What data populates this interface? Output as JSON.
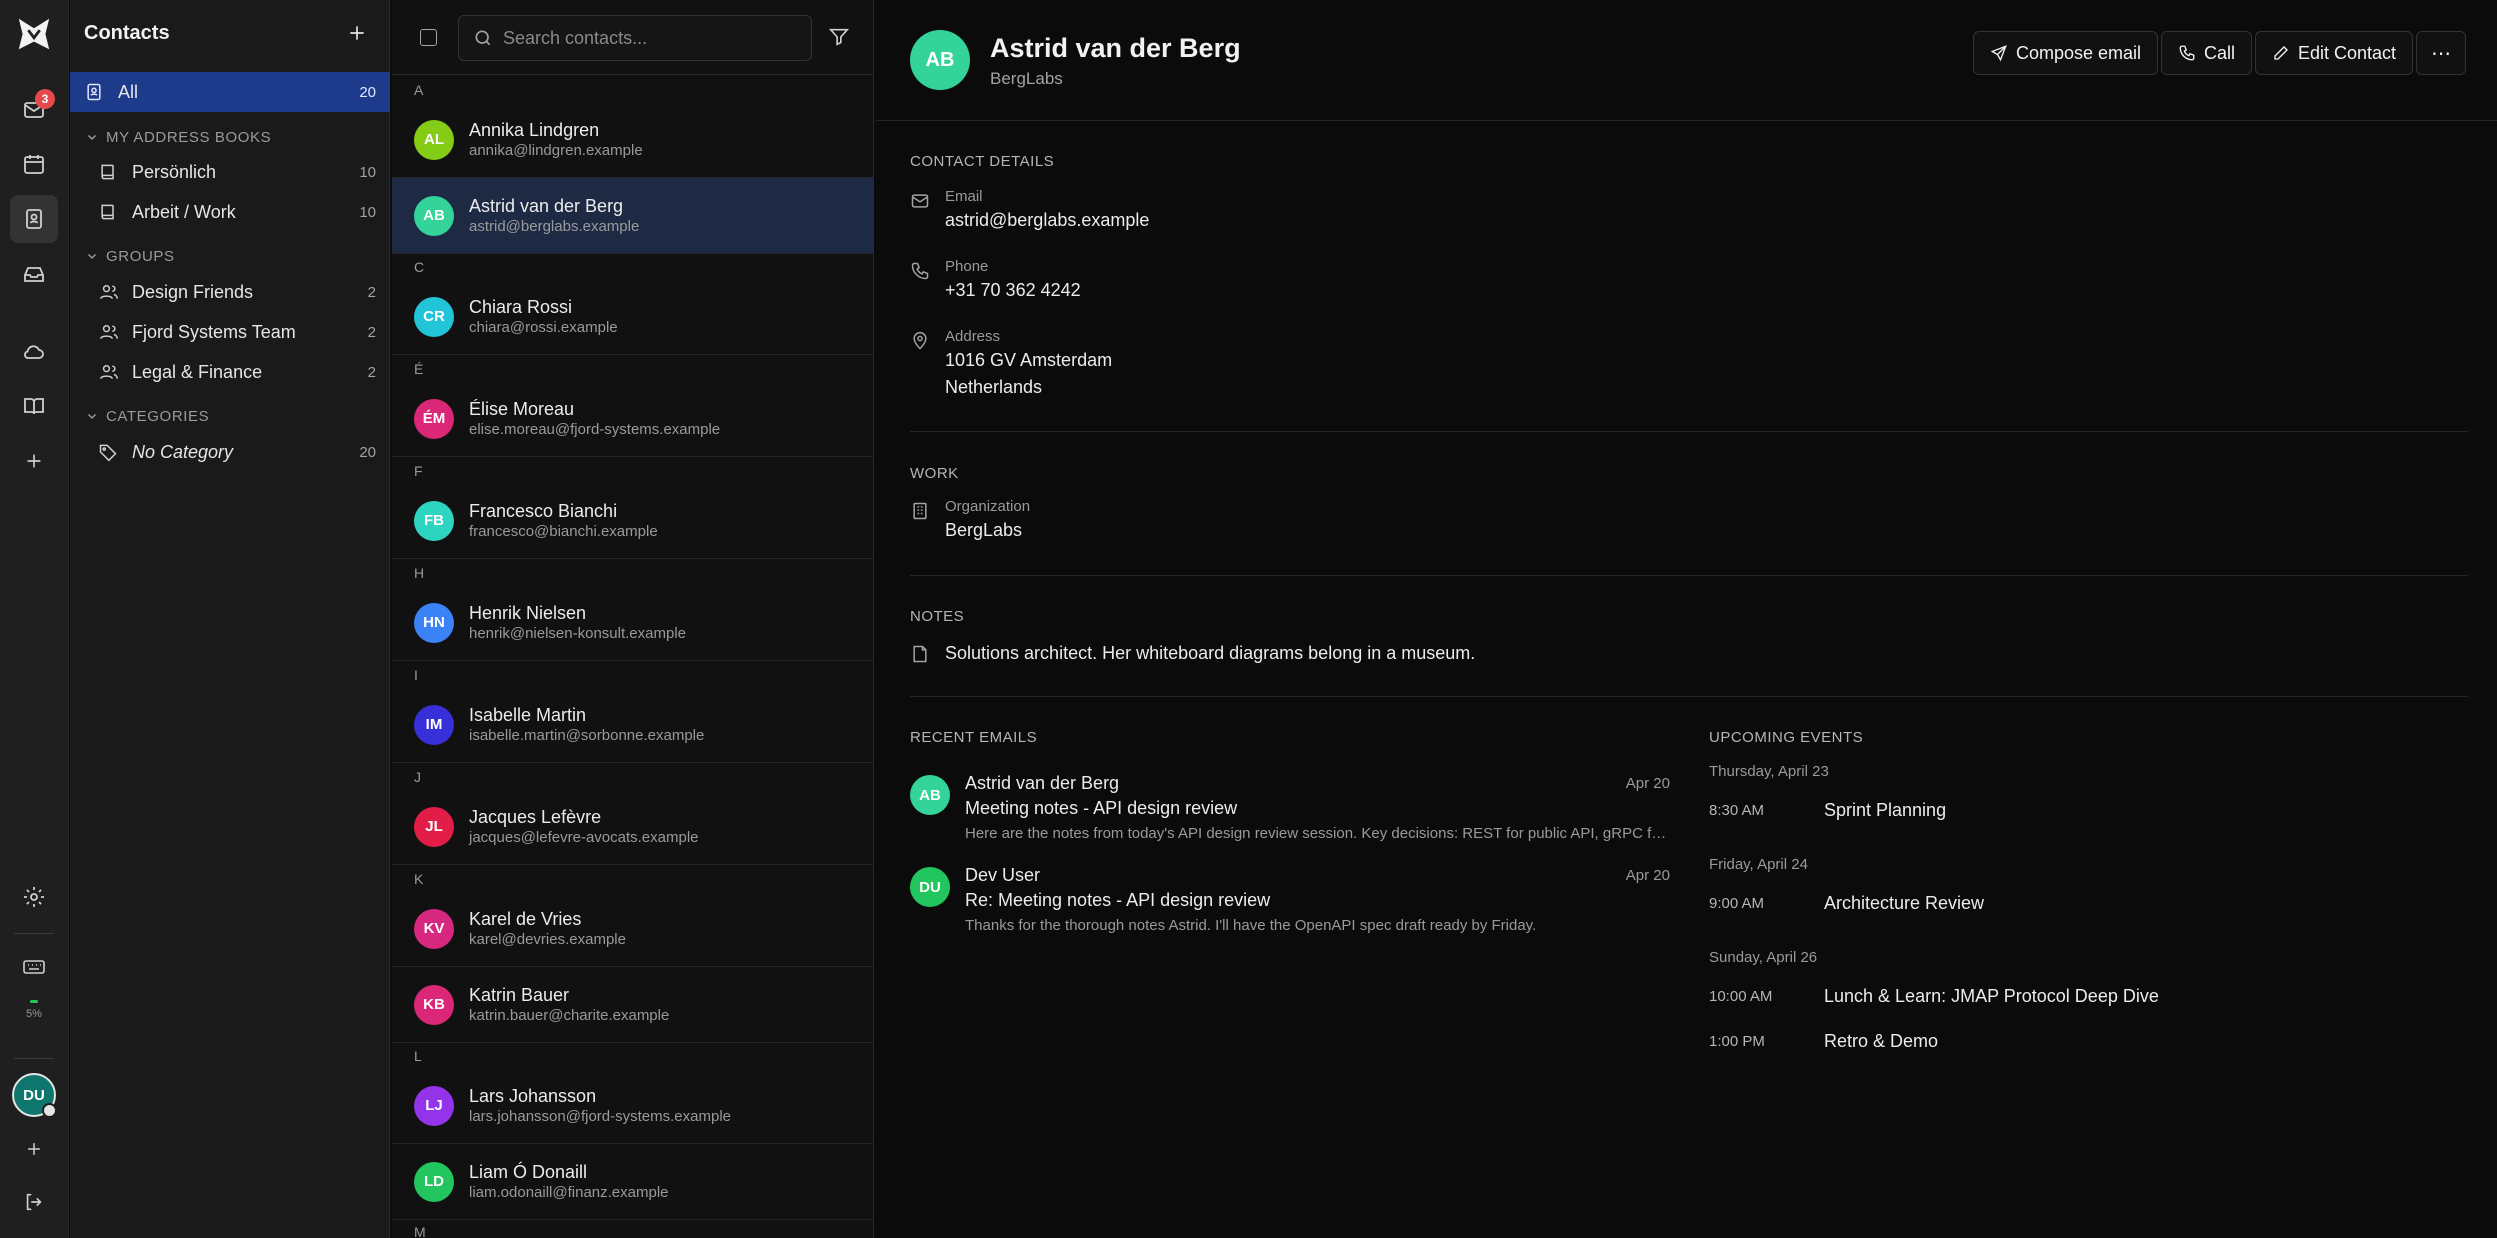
{
  "rail": {
    "mail_badge": "3",
    "quota": "5%",
    "avatar_initials": "DU"
  },
  "sidebar": {
    "title": "Contacts",
    "all": {
      "label": "All",
      "count": "20"
    },
    "address_books_header": "MY ADDRESS BOOKS",
    "address_books": [
      {
        "label": "Persönlich",
        "count": "10"
      },
      {
        "label": "Arbeit / Work",
        "count": "10"
      }
    ],
    "groups_header": "GROUPS",
    "groups": [
      {
        "label": "Design Friends",
        "count": "2"
      },
      {
        "label": "Fjord Systems Team",
        "count": "2"
      },
      {
        "label": "Legal & Finance",
        "count": "2"
      }
    ],
    "categories_header": "CATEGORIES",
    "categories": [
      {
        "label": "No Category",
        "count": "20"
      }
    ]
  },
  "list": {
    "search_placeholder": "Search contacts...",
    "letters": [
      "A",
      "C",
      "É",
      "F",
      "H",
      "I",
      "J",
      "K",
      "L",
      "M"
    ],
    "contacts": [
      {
        "initials": "AL",
        "name": "Annika Lindgren",
        "email": "annika@lindgren.example",
        "color": "#84cc16"
      },
      {
        "initials": "AB",
        "name": "Astrid van der Berg",
        "email": "astrid@berglabs.example",
        "color": "#34d399"
      },
      {
        "initials": "CR",
        "name": "Chiara Rossi",
        "email": "chiara@rossi.example",
        "color": "#22c5d8"
      },
      {
        "initials": "ÉM",
        "name": "Élise Moreau",
        "email": "elise.moreau@fjord-systems.example",
        "color": "#db2777"
      },
      {
        "initials": "FB",
        "name": "Francesco Bianchi",
        "email": "francesco@bianchi.example",
        "color": "#2dd4bf"
      },
      {
        "initials": "HN",
        "name": "Henrik Nielsen",
        "email": "henrik@nielsen-konsult.example",
        "color": "#3b82f6"
      },
      {
        "initials": "IM",
        "name": "Isabelle Martin",
        "email": "isabelle.martin@sorbonne.example",
        "color": "#3730d8"
      },
      {
        "initials": "JL",
        "name": "Jacques Lefèvre",
        "email": "jacques@lefevre-avocats.example",
        "color": "#e11d48"
      },
      {
        "initials": "KV",
        "name": "Karel de Vries",
        "email": "karel@devries.example",
        "color": "#d6287f"
      },
      {
        "initials": "KB",
        "name": "Katrin Bauer",
        "email": "katrin.bauer@charite.example",
        "color": "#db2777"
      },
      {
        "initials": "LJ",
        "name": "Lars Johansson",
        "email": "lars.johansson@fjord-systems.example",
        "color": "#9333ea"
      },
      {
        "initials": "LD",
        "name": "Liam Ó Donaill",
        "email": "liam.odonaill@finanz.example",
        "color": "#22c55e"
      }
    ]
  },
  "detail": {
    "initials": "AB",
    "name": "Astrid van der Berg",
    "organization": "BergLabs",
    "actions": {
      "compose": "Compose email",
      "call": "Call",
      "edit": "Edit Contact",
      "more": "⋯"
    },
    "contact_details_title": "CONTACT DETAILS",
    "email_label": "Email",
    "email": "astrid@berglabs.example",
    "phone_label": "Phone",
    "phone": "+31 70 362 4242",
    "address_label": "Address",
    "address_line1": "1016 GV Amsterdam",
    "address_line2": "Netherlands",
    "work_title": "WORK",
    "org_label": "Organization",
    "org_value": "BergLabs",
    "notes_title": "NOTES",
    "notes": "Solutions architect. Her whiteboard diagrams belong in a museum.",
    "recent_emails_title": "RECENT EMAILS",
    "emails": [
      {
        "initials": "AB",
        "from": "Astrid van der Berg",
        "date": "Apr 20",
        "subject": "Meeting notes - API design review",
        "snippet": "Here are the notes from today's API design review session. Key decisions: REST for public API, gRPC for internal services",
        "color": "#34d399"
      },
      {
        "initials": "DU",
        "from": "Dev User",
        "date": "Apr 20",
        "subject": "Re: Meeting notes - API design review",
        "snippet": "Thanks for the thorough notes Astrid. I'll have the OpenAPI spec draft ready by Friday.",
        "color": "#22c55e"
      }
    ],
    "upcoming_title": "UPCOMING EVENTS",
    "days": [
      {
        "day": "Thursday, April 23",
        "events": [
          {
            "time": "8:30 AM",
            "title": "Sprint Planning"
          }
        ]
      },
      {
        "day": "Friday, April 24",
        "events": [
          {
            "time": "9:00 AM",
            "title": "Architecture Review"
          }
        ]
      },
      {
        "day": "Sunday, April 26",
        "events": [
          {
            "time": "10:00 AM",
            "title": "Lunch & Learn: JMAP Protocol Deep Dive"
          },
          {
            "time": "1:00 PM",
            "title": "Retro & Demo"
          }
        ]
      }
    ]
  }
}
